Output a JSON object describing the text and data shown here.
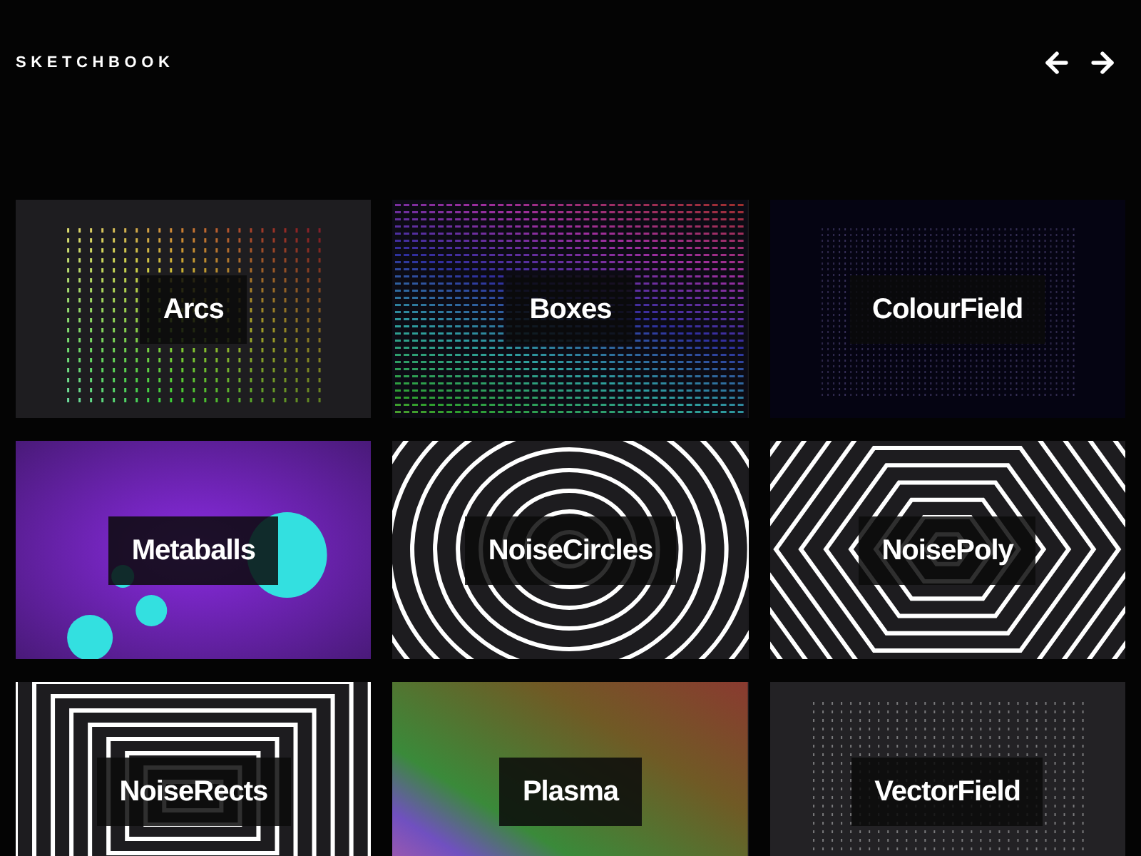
{
  "header": {
    "title": "SKETCHBOOK"
  },
  "sketches": [
    {
      "title": "Arcs",
      "kind": "dots"
    },
    {
      "title": "Boxes",
      "kind": "dashes"
    },
    {
      "title": "ColourField",
      "kind": "field"
    },
    {
      "title": "Metaballs",
      "kind": "blobs"
    },
    {
      "title": "NoiseCircles",
      "kind": "circles"
    },
    {
      "title": "NoisePoly",
      "kind": "poly"
    },
    {
      "title": "NoiseRects",
      "kind": "rects"
    },
    {
      "title": "Plasma",
      "kind": "gradient"
    },
    {
      "title": "VectorField",
      "kind": "vectors"
    }
  ]
}
